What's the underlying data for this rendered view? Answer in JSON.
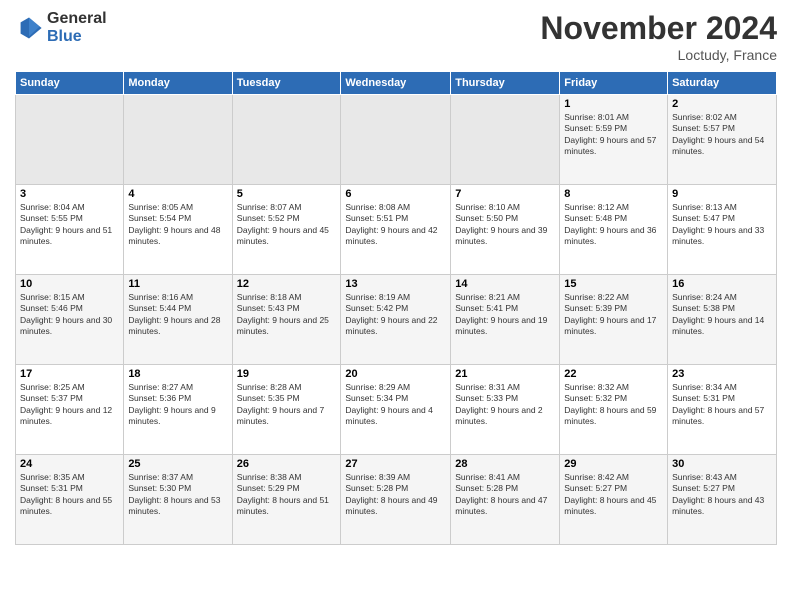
{
  "header": {
    "logo_line1": "General",
    "logo_line2": "Blue",
    "month": "November 2024",
    "location": "Loctudy, France"
  },
  "weekdays": [
    "Sunday",
    "Monday",
    "Tuesday",
    "Wednesday",
    "Thursday",
    "Friday",
    "Saturday"
  ],
  "weeks": [
    [
      {
        "day": "",
        "info": ""
      },
      {
        "day": "",
        "info": ""
      },
      {
        "day": "",
        "info": ""
      },
      {
        "day": "",
        "info": ""
      },
      {
        "day": "",
        "info": ""
      },
      {
        "day": "1",
        "info": "Sunrise: 8:01 AM\nSunset: 5:59 PM\nDaylight: 9 hours and 57 minutes."
      },
      {
        "day": "2",
        "info": "Sunrise: 8:02 AM\nSunset: 5:57 PM\nDaylight: 9 hours and 54 minutes."
      }
    ],
    [
      {
        "day": "3",
        "info": "Sunrise: 8:04 AM\nSunset: 5:55 PM\nDaylight: 9 hours and 51 minutes."
      },
      {
        "day": "4",
        "info": "Sunrise: 8:05 AM\nSunset: 5:54 PM\nDaylight: 9 hours and 48 minutes."
      },
      {
        "day": "5",
        "info": "Sunrise: 8:07 AM\nSunset: 5:52 PM\nDaylight: 9 hours and 45 minutes."
      },
      {
        "day": "6",
        "info": "Sunrise: 8:08 AM\nSunset: 5:51 PM\nDaylight: 9 hours and 42 minutes."
      },
      {
        "day": "7",
        "info": "Sunrise: 8:10 AM\nSunset: 5:50 PM\nDaylight: 9 hours and 39 minutes."
      },
      {
        "day": "8",
        "info": "Sunrise: 8:12 AM\nSunset: 5:48 PM\nDaylight: 9 hours and 36 minutes."
      },
      {
        "day": "9",
        "info": "Sunrise: 8:13 AM\nSunset: 5:47 PM\nDaylight: 9 hours and 33 minutes."
      }
    ],
    [
      {
        "day": "10",
        "info": "Sunrise: 8:15 AM\nSunset: 5:46 PM\nDaylight: 9 hours and 30 minutes."
      },
      {
        "day": "11",
        "info": "Sunrise: 8:16 AM\nSunset: 5:44 PM\nDaylight: 9 hours and 28 minutes."
      },
      {
        "day": "12",
        "info": "Sunrise: 8:18 AM\nSunset: 5:43 PM\nDaylight: 9 hours and 25 minutes."
      },
      {
        "day": "13",
        "info": "Sunrise: 8:19 AM\nSunset: 5:42 PM\nDaylight: 9 hours and 22 minutes."
      },
      {
        "day": "14",
        "info": "Sunrise: 8:21 AM\nSunset: 5:41 PM\nDaylight: 9 hours and 19 minutes."
      },
      {
        "day": "15",
        "info": "Sunrise: 8:22 AM\nSunset: 5:39 PM\nDaylight: 9 hours and 17 minutes."
      },
      {
        "day": "16",
        "info": "Sunrise: 8:24 AM\nSunset: 5:38 PM\nDaylight: 9 hours and 14 minutes."
      }
    ],
    [
      {
        "day": "17",
        "info": "Sunrise: 8:25 AM\nSunset: 5:37 PM\nDaylight: 9 hours and 12 minutes."
      },
      {
        "day": "18",
        "info": "Sunrise: 8:27 AM\nSunset: 5:36 PM\nDaylight: 9 hours and 9 minutes."
      },
      {
        "day": "19",
        "info": "Sunrise: 8:28 AM\nSunset: 5:35 PM\nDaylight: 9 hours and 7 minutes."
      },
      {
        "day": "20",
        "info": "Sunrise: 8:29 AM\nSunset: 5:34 PM\nDaylight: 9 hours and 4 minutes."
      },
      {
        "day": "21",
        "info": "Sunrise: 8:31 AM\nSunset: 5:33 PM\nDaylight: 9 hours and 2 minutes."
      },
      {
        "day": "22",
        "info": "Sunrise: 8:32 AM\nSunset: 5:32 PM\nDaylight: 8 hours and 59 minutes."
      },
      {
        "day": "23",
        "info": "Sunrise: 8:34 AM\nSunset: 5:31 PM\nDaylight: 8 hours and 57 minutes."
      }
    ],
    [
      {
        "day": "24",
        "info": "Sunrise: 8:35 AM\nSunset: 5:31 PM\nDaylight: 8 hours and 55 minutes."
      },
      {
        "day": "25",
        "info": "Sunrise: 8:37 AM\nSunset: 5:30 PM\nDaylight: 8 hours and 53 minutes."
      },
      {
        "day": "26",
        "info": "Sunrise: 8:38 AM\nSunset: 5:29 PM\nDaylight: 8 hours and 51 minutes."
      },
      {
        "day": "27",
        "info": "Sunrise: 8:39 AM\nSunset: 5:28 PM\nDaylight: 8 hours and 49 minutes."
      },
      {
        "day": "28",
        "info": "Sunrise: 8:41 AM\nSunset: 5:28 PM\nDaylight: 8 hours and 47 minutes."
      },
      {
        "day": "29",
        "info": "Sunrise: 8:42 AM\nSunset: 5:27 PM\nDaylight: 8 hours and 45 minutes."
      },
      {
        "day": "30",
        "info": "Sunrise: 8:43 AM\nSunset: 5:27 PM\nDaylight: 8 hours and 43 minutes."
      }
    ]
  ]
}
